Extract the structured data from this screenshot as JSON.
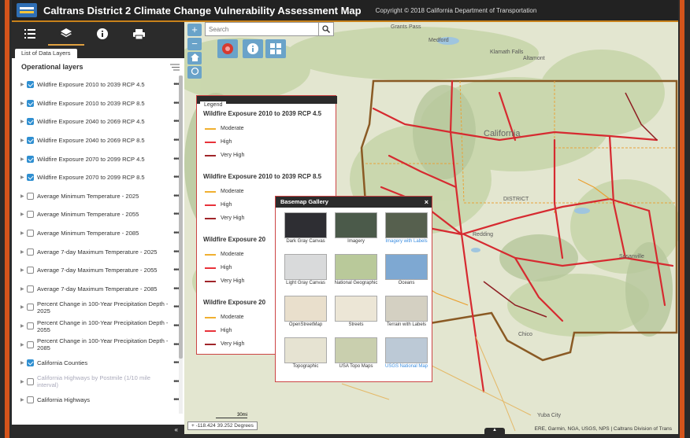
{
  "header": {
    "title": "Caltrans District 2 Climate Change Vulnerability Assessment Map",
    "copyright": "Copyright © 2018 California Department of Transportation"
  },
  "toolbar": {
    "icons": [
      "list-icon",
      "layers-icon",
      "info-icon",
      "print-icon"
    ]
  },
  "sidebar": {
    "tab_label": "List of Data Layers",
    "section_title": "Operational layers",
    "layers": [
      {
        "label": "Wildfire Exposure 2010 to 2039 RCP 4.5",
        "checked": true
      },
      {
        "label": "Wildfire Exposure 2010 to 2039 RCP 8.5",
        "checked": true
      },
      {
        "label": "Wildfire Exposure 2040 to 2069 RCP 4.5",
        "checked": true
      },
      {
        "label": "Wildfire Exposure 2040 to 2069 RCP 8.5",
        "checked": true
      },
      {
        "label": "Wildfire Exposure 2070 to 2099 RCP 4.5",
        "checked": true
      },
      {
        "label": "Wildfire Exposure 2070 to 2099 RCP 8.5",
        "checked": true
      },
      {
        "label": "Average Minimum Temperature - 2025",
        "checked": false
      },
      {
        "label": "Average Minimum Temperature - 2055",
        "checked": false
      },
      {
        "label": "Average Minimum Temperature - 2085",
        "checked": false
      },
      {
        "label": "Average 7-day Maximum Temperature - 2025",
        "checked": false
      },
      {
        "label": "Average 7-day Maximum Temperature - 2055",
        "checked": false
      },
      {
        "label": "Average 7-day Maximum Temperature - 2085",
        "checked": false
      },
      {
        "label": "Percent Change in 100-Year Precipitation Depth - 2025",
        "checked": false
      },
      {
        "label": "Percent Change in 100-Year Precipitation Depth - 2055",
        "checked": false
      },
      {
        "label": "Percent Change in 100-Year Precipitation Depth - 2085",
        "checked": false
      },
      {
        "label": "California Counties",
        "checked": true
      },
      {
        "label": "California Highways by Postmile (1/10 mile interval)",
        "checked": false,
        "dim": true
      },
      {
        "label": "California Highways",
        "checked": false
      }
    ],
    "collapse_glyph": "«"
  },
  "map": {
    "search_placeholder": "Search",
    "zoom_in": "+",
    "zoom_out": "−",
    "coordinates": "-118.424 39.252 Degrees",
    "scale": "30mi",
    "attribution": "ERE, Garmin, NGA, USGS, NPS | Caltrans Division of Trans",
    "labels": {
      "california": "California",
      "district": "DISTRICT",
      "chico": "Chico",
      "yuba_city": "Yuba City",
      "grants_pass": "Grants Pass",
      "medford": "Medford",
      "klamath_falls": "Klamath Falls",
      "altamont": "Altamont",
      "redding": "Redding",
      "susanville": "Susanville"
    }
  },
  "legend": {
    "tab": "Legend",
    "groups": [
      {
        "title": "Wildfire Exposure 2010 to 2039 RCP 4.5",
        "items": [
          "Moderate",
          "High",
          "Very High"
        ]
      },
      {
        "title": "Wildfire Exposure 2010 to 2039 RCP 8.5",
        "items": [
          "Moderate",
          "High",
          "Very High"
        ]
      },
      {
        "title": "Wildfire Exposure 20",
        "items": [
          "Moderate",
          "High",
          "Very High"
        ]
      },
      {
        "title": "Wildfire Exposure 20",
        "items": [
          "Moderate",
          "High",
          "Very High"
        ]
      }
    ],
    "colors": {
      "Moderate": "#f0b030",
      "High": "#e8323a",
      "Very High": "#a0252a"
    }
  },
  "gallery": {
    "title": "Basemap Gallery",
    "close": "×",
    "items": [
      {
        "label": "Dark Gray Canvas",
        "selected": false,
        "color": "#2e2e33"
      },
      {
        "label": "Imagery",
        "selected": false,
        "color": "#4b5a4a"
      },
      {
        "label": "Imagery with Labels",
        "selected": true,
        "color": "#56604e"
      },
      {
        "label": "Light Gray Canvas",
        "selected": false,
        "color": "#d9dadb"
      },
      {
        "label": "National Geographic",
        "selected": false,
        "color": "#b9c99a"
      },
      {
        "label": "Oceans",
        "selected": false,
        "color": "#7ea8d2"
      },
      {
        "label": "OpenStreetMap",
        "selected": false,
        "color": "#e9dfcc"
      },
      {
        "label": "Streets",
        "selected": false,
        "color": "#ece6d6"
      },
      {
        "label": "Terrain with Labels",
        "selected": false,
        "color": "#d4d0c2"
      },
      {
        "label": "Topographic",
        "selected": false,
        "color": "#e6e3d2"
      },
      {
        "label": "USA Topo Maps",
        "selected": false,
        "color": "#c9cfae"
      },
      {
        "label": "USGS National Map",
        "selected": true,
        "color": "#bcc9d6"
      }
    ]
  }
}
